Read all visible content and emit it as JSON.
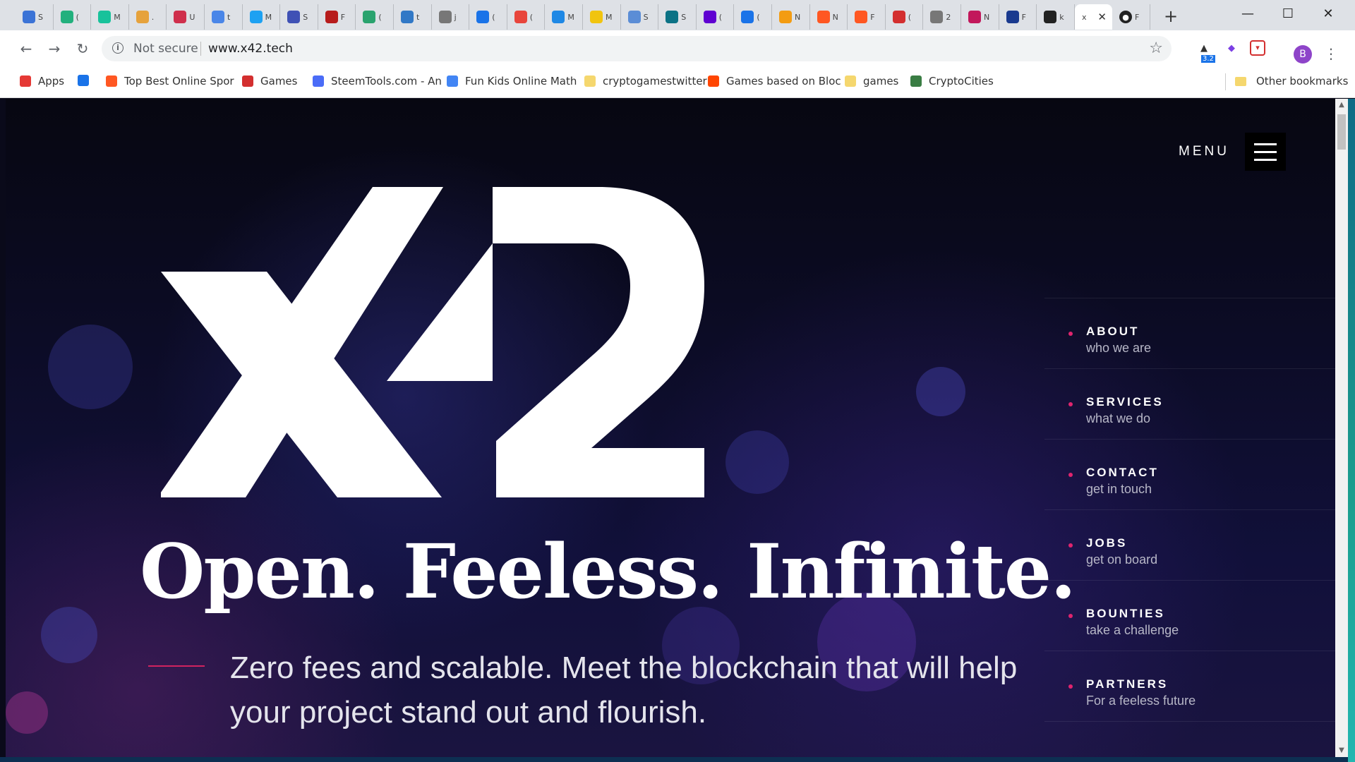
{
  "browser": {
    "tabs": [
      {
        "letter": "S",
        "icon": "#3b73d6"
      },
      {
        "letter": "(",
        "icon": "#22b07d"
      },
      {
        "letter": "M",
        "icon": "#18c29b"
      },
      {
        "letter": ".",
        "icon": "#e6a23c"
      },
      {
        "letter": "U",
        "icon": "#cf2f4c"
      },
      {
        "letter": "t",
        "icon": "#4a86e8"
      },
      {
        "letter": "M",
        "icon": "#1da1f2"
      },
      {
        "letter": "S",
        "icon": "#3f51b5"
      },
      {
        "letter": "F",
        "icon": "#b71c1c"
      },
      {
        "letter": "(",
        "icon": "#2aa36e"
      },
      {
        "letter": "t",
        "icon": "#3178c6"
      },
      {
        "letter": "j",
        "icon": "#777777"
      },
      {
        "letter": "(",
        "icon": "#1a73e8"
      },
      {
        "letter": "(",
        "icon": "#e8453c"
      },
      {
        "letter": "M",
        "icon": "#1e88e5"
      },
      {
        "letter": "M",
        "icon": "#f1c40f"
      },
      {
        "letter": "S",
        "icon": "#5b8dd6"
      },
      {
        "letter": "S",
        "icon": "#0b7285"
      },
      {
        "letter": "(",
        "icon": "#5f01d1"
      },
      {
        "letter": "(",
        "icon": "#1a73e8"
      },
      {
        "letter": "N",
        "icon": "#f39c12"
      },
      {
        "letter": "N",
        "icon": "#ff5722"
      },
      {
        "letter": "F",
        "icon": "#ff5722"
      },
      {
        "letter": "(",
        "icon": "#d32f2f"
      },
      {
        "letter": "2",
        "icon": "#777777"
      },
      {
        "letter": "N",
        "icon": "#c2185b"
      },
      {
        "letter": "F",
        "icon": "#1a3a8f"
      },
      {
        "letter": "k",
        "icon": "#222222"
      }
    ],
    "active_tab": {
      "title": "x",
      "close": "✕"
    },
    "github_tab": {
      "letter": "F"
    },
    "new_tab": "+",
    "window_controls": {
      "minimize": "—",
      "maximize": "☐",
      "close": "✕"
    },
    "nav": {
      "back": "←",
      "forward": "→",
      "reload": "↻"
    },
    "omnibox": {
      "security_label": "Not secure",
      "url": "www.x42.tech"
    },
    "extensions": {
      "badge": "3.2",
      "avatar_initial": "B"
    },
    "bookmarks": [
      {
        "label": "Apps",
        "color": "#e53935"
      },
      {
        "label": "",
        "color": "#1a73e8"
      },
      {
        "label": "Top Best Online Spor",
        "color": "#ff5722"
      },
      {
        "label": "Games",
        "color": "#d32f2f"
      },
      {
        "label": "SteemTools.com - An",
        "color": "#4a6cf7"
      },
      {
        "label": "Fun Kids Online Math",
        "color": "#4285f4"
      },
      {
        "label": "cryptogamestwitter",
        "color": "#f5d76e"
      },
      {
        "label": "Games based on Bloc",
        "color": "#ff4500"
      },
      {
        "label": "games",
        "color": "#f5d76e"
      },
      {
        "label": "CryptoCities",
        "color": "#3a7d44"
      }
    ],
    "other_bookmarks": "Other bookmarks"
  },
  "page": {
    "menu_label": "MENU",
    "logo_alt": "x42",
    "headline": "Open. Feeless. Infinite.",
    "subtext": "Zero fees and scalable. Meet the blockchain that will help your project stand out and flourish.",
    "nav": [
      {
        "title": "ABOUT",
        "subtitle": "who we are"
      },
      {
        "title": "SERVICES",
        "subtitle": "what we do"
      },
      {
        "title": "CONTACT",
        "subtitle": "get in touch"
      },
      {
        "title": "JOBS",
        "subtitle": "get on board"
      },
      {
        "title": "BOUNTIES",
        "subtitle": "take a challenge"
      },
      {
        "title": "PARTNERS",
        "subtitle": "For a feeless future"
      }
    ]
  },
  "colors": {
    "accent": "#e0246e",
    "background": "#0a0a1a",
    "text": "#ffffff"
  }
}
